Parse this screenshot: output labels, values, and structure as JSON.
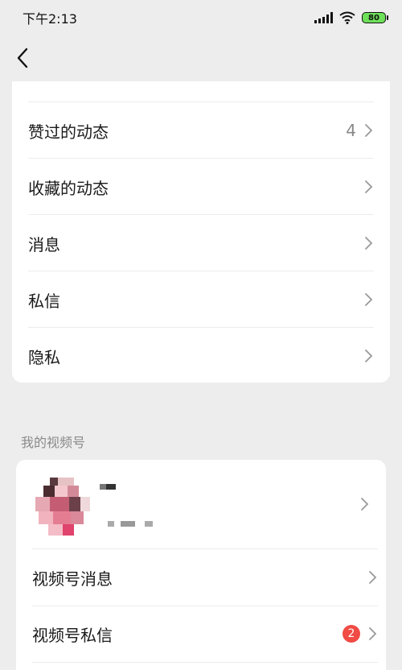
{
  "status_bar": {
    "time": "下午2:13",
    "battery": "80"
  },
  "nav": {
    "back_icon": "chevron-left-icon"
  },
  "activity_menu": {
    "items": [
      {
        "label": "赞过的动态",
        "count": "4"
      },
      {
        "label": "收藏的动态"
      },
      {
        "label": "消息"
      },
      {
        "label": "私信"
      },
      {
        "label": "隐私"
      }
    ]
  },
  "channels": {
    "section_title": "我的视频号",
    "items": [
      {
        "label": "视频号消息"
      },
      {
        "label": "视频号私信",
        "badge": "2"
      }
    ]
  },
  "colors": {
    "background": "#ededed",
    "card": "#ffffff",
    "badge": "#f04b44",
    "battery": "#6ee05a"
  }
}
